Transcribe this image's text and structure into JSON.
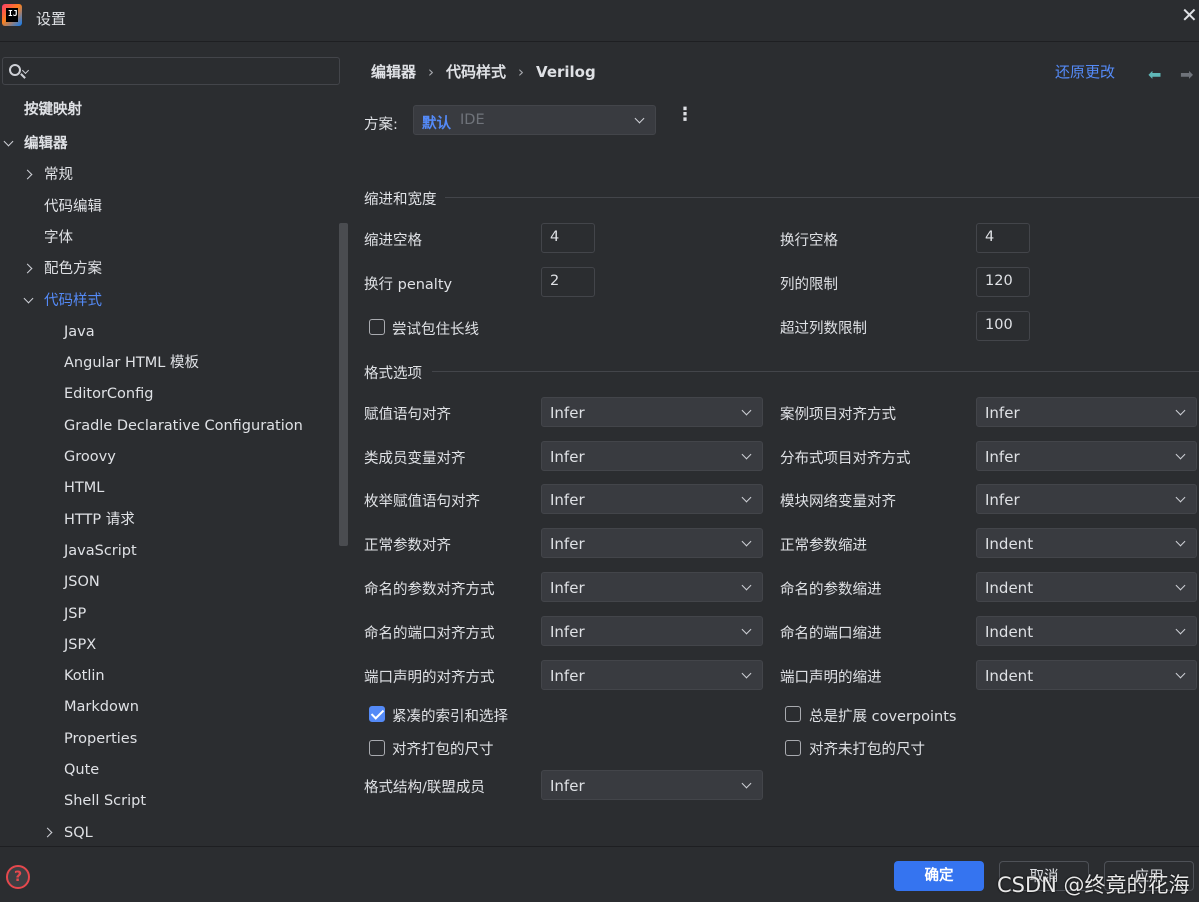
{
  "window": {
    "title": "设置",
    "close_glyph": "✕"
  },
  "sidebar": {
    "search_placeholder": "",
    "items": [
      {
        "label": "按键映射",
        "level": 0,
        "bold": true,
        "chevron": "none"
      },
      {
        "label": "编辑器",
        "level": 0,
        "bold": true,
        "chevron": "down"
      },
      {
        "label": "常规",
        "level": 1,
        "chevron": "right"
      },
      {
        "label": "代码编辑",
        "level": 1,
        "chevron": "none"
      },
      {
        "label": "字体",
        "level": 1,
        "chevron": "none"
      },
      {
        "label": "配色方案",
        "level": 1,
        "chevron": "right"
      },
      {
        "label": "代码样式",
        "level": 1,
        "chevron": "down",
        "selected": true
      },
      {
        "label": "Java",
        "level": 2
      },
      {
        "label": "Angular HTML 模板",
        "level": 2
      },
      {
        "label": "EditorConfig",
        "level": 2
      },
      {
        "label": "Gradle Declarative Configuration",
        "level": 2
      },
      {
        "label": "Groovy",
        "level": 2
      },
      {
        "label": "HTML",
        "level": 2
      },
      {
        "label": "HTTP 请求",
        "level": 2
      },
      {
        "label": "JavaScript",
        "level": 2
      },
      {
        "label": "JSON",
        "level": 2
      },
      {
        "label": "JSP",
        "level": 2
      },
      {
        "label": "JSPX",
        "level": 2
      },
      {
        "label": "Kotlin",
        "level": 2
      },
      {
        "label": "Markdown",
        "level": 2
      },
      {
        "label": "Properties",
        "level": 2
      },
      {
        "label": "Qute",
        "level": 2
      },
      {
        "label": "Shell Script",
        "level": 2
      },
      {
        "label": "SQL",
        "level": 2,
        "chevron": "right"
      }
    ]
  },
  "breadcrumb": {
    "part1": "编辑器",
    "part2": "代码样式",
    "part3": "Verilog",
    "sep": "›"
  },
  "header": {
    "reset_label": "还原更改",
    "back_glyph": "⬅",
    "forward_glyph": "➡"
  },
  "scheme": {
    "label": "方案:",
    "value": "默认",
    "suffix": "IDE",
    "more_glyph": "⋮"
  },
  "indent_section": {
    "title": "缩进和宽度",
    "indent_label": "缩进空格",
    "indent_value": "4",
    "wrap_indent_label": "换行空格",
    "wrap_indent_value": "4",
    "wrap_penalty_label": "换行 penalty",
    "wrap_penalty_value": "2",
    "col_limit_label": "列的限制",
    "col_limit_value": "120",
    "try_wrap_label": "尝试包住长线",
    "try_wrap_checked": false,
    "exceed_limit_label": "超过列数限制",
    "exceed_limit_value": "100"
  },
  "format_section": {
    "title": "格式选项",
    "left": [
      {
        "label": "赋值语句对齐",
        "value": "Infer"
      },
      {
        "label": "类成员变量对齐",
        "value": "Infer"
      },
      {
        "label": "枚举赋值语句对齐",
        "value": "Infer"
      },
      {
        "label": "正常参数对齐",
        "value": "Infer"
      },
      {
        "label": "命名的参数对齐方式",
        "value": "Infer"
      },
      {
        "label": "命名的端口对齐方式",
        "value": "Infer"
      },
      {
        "label": "端口声明的对齐方式",
        "value": "Infer"
      }
    ],
    "right": [
      {
        "label": "案例项目对齐方式",
        "value": "Infer"
      },
      {
        "label": "分布式项目对齐方式",
        "value": "Infer"
      },
      {
        "label": "模块网络变量对齐",
        "value": "Infer"
      },
      {
        "label": "正常参数缩进",
        "value": "Indent"
      },
      {
        "label": "命名的参数缩进",
        "value": "Indent"
      },
      {
        "label": "命名的端口缩进",
        "value": "Indent"
      },
      {
        "label": "端口声明的缩进",
        "value": "Indent"
      }
    ],
    "compact_label": "紧凑的索引和选择",
    "compact_checked": true,
    "expand_label": "总是扩展 coverpoints",
    "expand_checked": false,
    "align_packed_label": "对齐打包的尺寸",
    "align_packed_checked": false,
    "align_unpacked_label": "对齐未打包的尺寸",
    "align_unpacked_checked": false,
    "struct_label": "格式结构/联盟成员",
    "struct_value": "Infer"
  },
  "footer": {
    "help_glyph": "?",
    "ok_label": "确定",
    "cancel_label": "取消",
    "apply_label": "应用",
    "watermark": "CSDN @终竟的花海"
  },
  "colors": {
    "accent": "#548af7",
    "primary_button": "#3574f0",
    "background": "#2b2d30"
  }
}
